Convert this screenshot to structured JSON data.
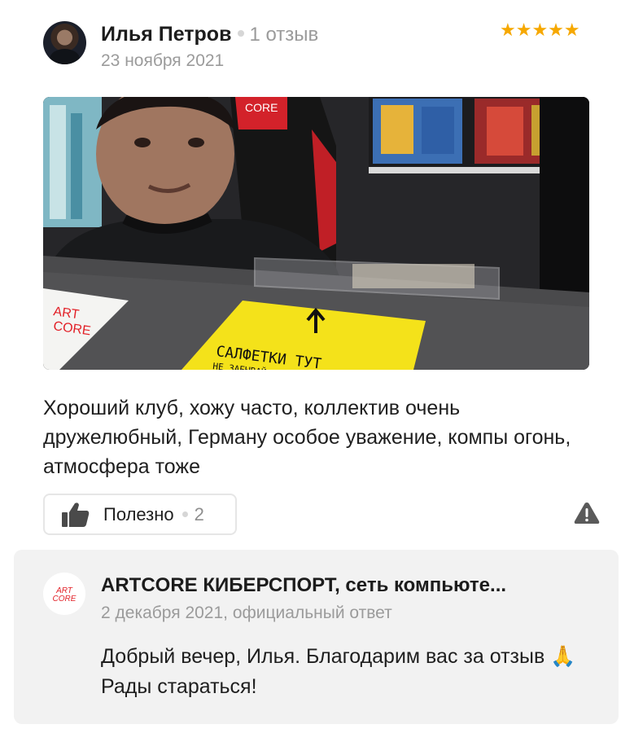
{
  "review": {
    "author": "Илья Петров",
    "review_count": "1 отзыв",
    "date": "23 ноября 2021",
    "rating": 5,
    "stars": "★★★★★",
    "text": "Хороший клуб, хожу часто, коллектив очень дружелюбный, Герману особое уважение, компы огонь, атмосфера тоже",
    "photo": {
      "logo_text": "CORE",
      "sign_text_1": "САЛФЕТКИ ТУТ",
      "sign_text_2": "НЕ ЗАБЫВАЙ",
      "paper_text_1": "ART",
      "paper_text_2": "CORE"
    },
    "useful_label": "Полезно",
    "useful_count": "2",
    "thumb_icon": "thumbs-up-icon",
    "report_icon": "warning-icon"
  },
  "reply": {
    "logo_text_1": "ART",
    "logo_text_2": "CORE",
    "author": "ARTCORE КИБЕРСПОРТ, сеть компьюте...",
    "date": "2 декабря 2021, официальный ответ",
    "text": "Добрый вечер, Илья. Благодарим вас за отзыв 🙏 Рады стараться!"
  },
  "colors": {
    "star": "#f6a800",
    "secondary_text": "#9b9b9b",
    "reply_bg": "#f2f2f2",
    "brand_red": "#e21f26"
  }
}
